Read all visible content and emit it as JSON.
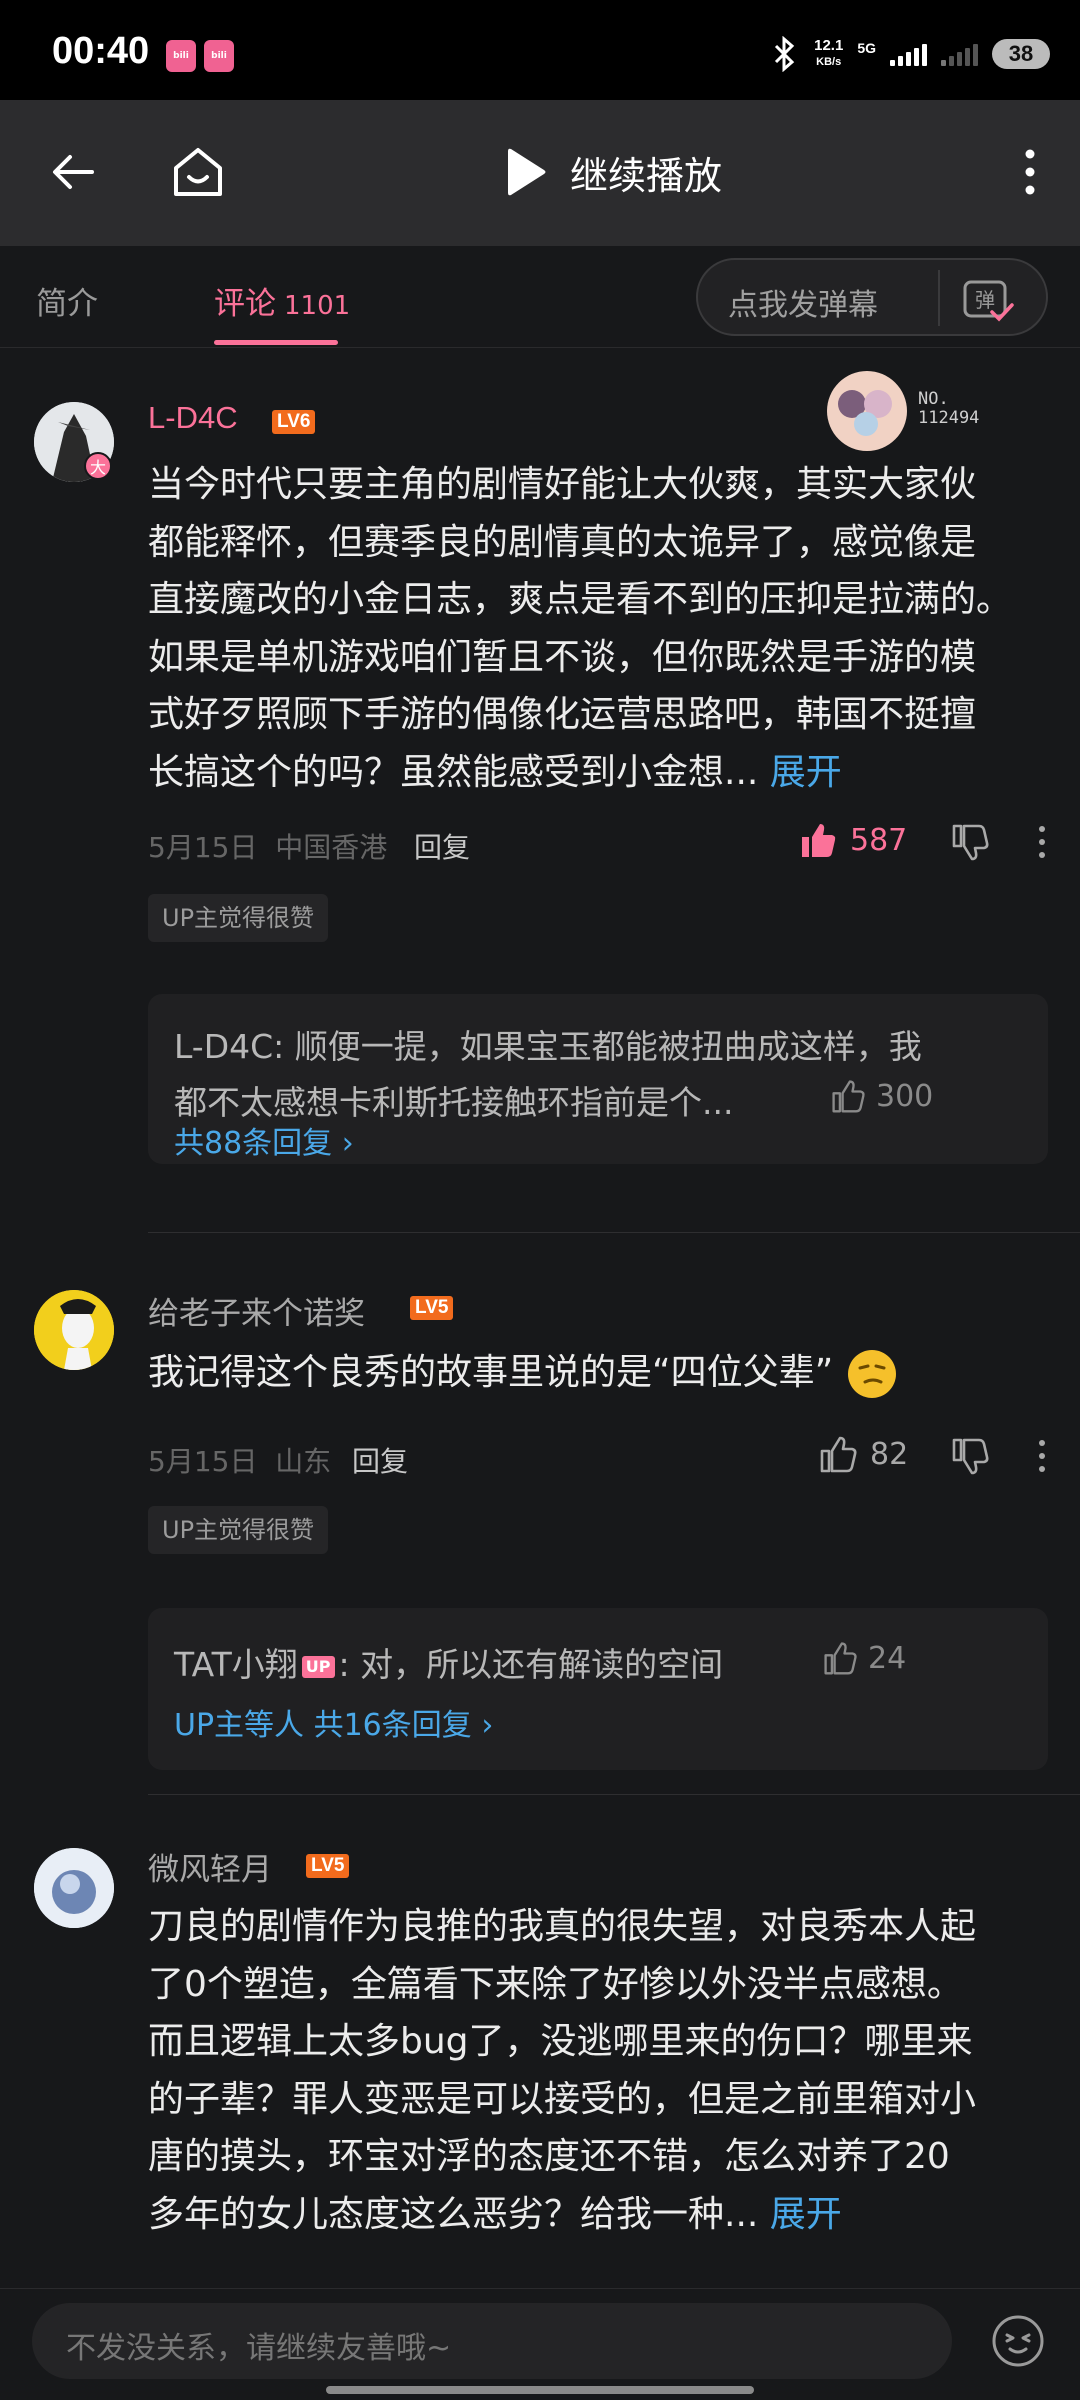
{
  "status_bar": {
    "time": "00:40",
    "network_speed": "12.1",
    "network_unit": "KB/s",
    "network_type": "5G",
    "battery": "38"
  },
  "nav": {
    "continue_play_label": "继续播放",
    "back_icon": "arrow-left-icon",
    "home_icon": "home-icon",
    "play_icon": "play-icon",
    "more_icon": "more-vertical-icon"
  },
  "tabs": {
    "intro": "简介",
    "comments": "评论",
    "comments_count": "1101",
    "danmaku_placeholder": "点我发弹幕",
    "danmaku_icon_label": "弹"
  },
  "comments": [
    {
      "username": "L-D4C",
      "level": "LV6",
      "avatar_badge": "大",
      "fan_badge_text": "NO.\n112494",
      "lines": [
        "当今时代只要主角的剧情好能让大伙爽，其实大家伙",
        "都能释怀，但赛季良的剧情真的太诡异了，感觉像是",
        "直接魔改的小金日志，爽点是看不到的压抑是拉满的。",
        "如果是单机游戏咱们暂且不谈，但你既然是手游的模",
        "式好歹照顾下手游的偶像化运营思路吧，韩国不挺擅",
        "长搞这个的吗？虽然能感受到小金想..."
      ],
      "expand": "展开",
      "date": "5月15日",
      "location": "中国香港",
      "reply": "回复",
      "likes": "587",
      "up_tag": "UP主觉得很赞",
      "sub_reply": {
        "author": "L-D4C",
        "line1": "顺便一提，如果宝玉都能被扭曲成这样，我",
        "line2": "都不太感想卡利斯托接触环指前是个...",
        "likes": "300",
        "more": "共88条回复"
      }
    },
    {
      "username": "给老子来个诺奖",
      "level": "LV5",
      "text": "我记得这个良秀的故事里说的是“四位父辈”",
      "date": "5月15日",
      "location": "山东",
      "reply": "回复",
      "likes": "82",
      "up_tag": "UP主觉得很赞",
      "sub_reply": {
        "author": "TAT小翔",
        "up_badge": "UP",
        "text": ": 对，所以还有解读的空间",
        "likes": "24",
        "more": "UP主等人 共16条回复"
      }
    },
    {
      "username": "微风轻月",
      "level": "LV5",
      "lines": [
        "刀良的剧情作为良推的我真的很失望，对良秀本人起",
        "了0个塑造，全篇看下来除了好惨以外没半点感想。",
        "而且逻辑上太多bug了，没逃哪里来的伤口？哪里来",
        "的子辈？罪人变恶是可以接受的，但是之前里箱对小",
        "唐的摸头，环宝对浮的态度还不错，怎么对养了20",
        "多年的女儿态度这么恶劣？给我一种..."
      ],
      "expand": "展开"
    }
  ],
  "bottom": {
    "placeholder": "不发没关系，请继续友善哦~"
  },
  "colors": {
    "accent_pink": "#fb7299",
    "link_blue": "#4aa8e8",
    "level_orange": "#f26b1d",
    "background": "#17181a"
  }
}
